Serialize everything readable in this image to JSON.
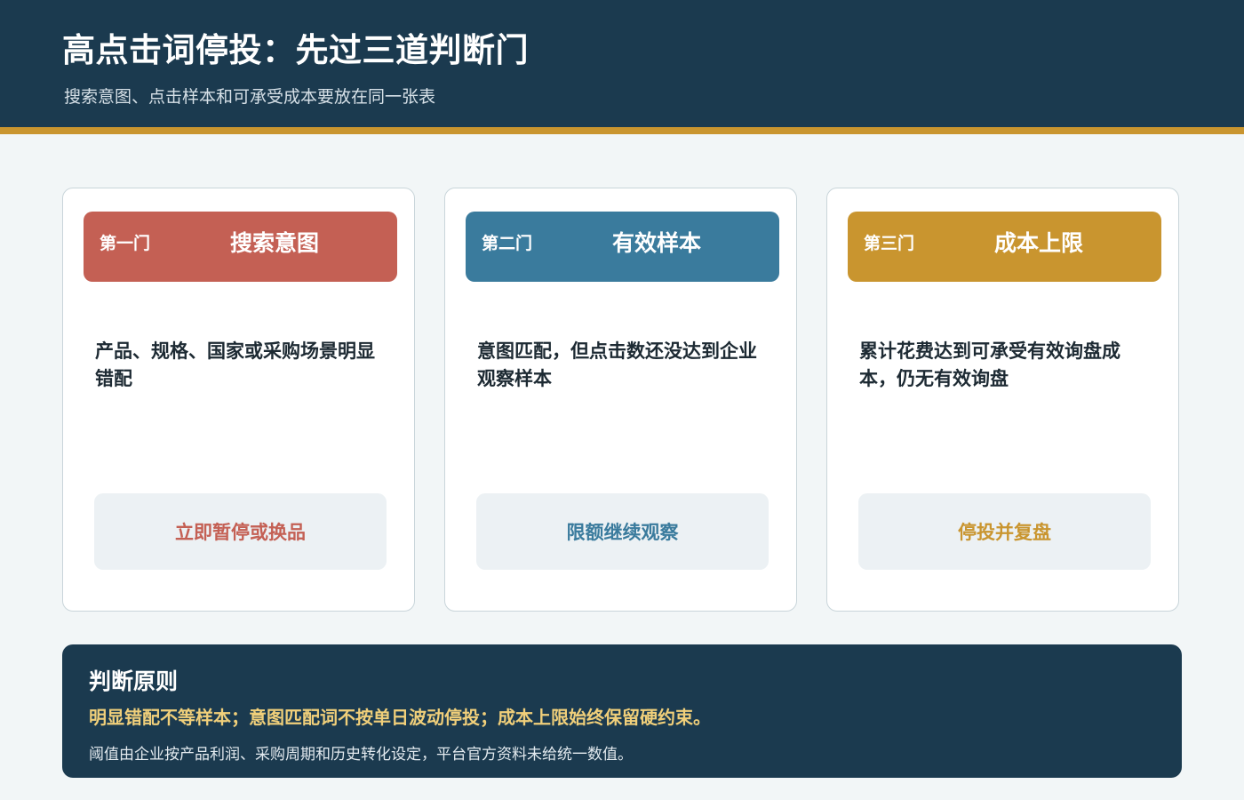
{
  "header": {
    "title": "高点击词停投：先过三道判断门",
    "subtitle": "搜索意图、点击样本和可承受成本要放在同一张表"
  },
  "colors": {
    "header_bg": "#1b3a4f",
    "accent_stripe": "#c9952f",
    "gate_1": "#c46054",
    "gate_2": "#3a7b9d",
    "gate_3": "#c9952f"
  },
  "gates": [
    {
      "label": "第一门",
      "title": "搜索意图",
      "description": "产品、规格、国家或采购场景明显错配",
      "action": "立即暂停或换品"
    },
    {
      "label": "第二门",
      "title": "有效样本",
      "description": "意图匹配，但点击数还没达到企业观察样本",
      "action": "限额继续观察"
    },
    {
      "label": "第三门",
      "title": "成本上限",
      "description": "累计花费达到可承受有效询盘成本，仍无有效询盘",
      "action": "停投并复盘"
    }
  ],
  "principle": {
    "heading": "判断原则",
    "highlight": "明显错配不等样本；意图匹配词不按单日波动停投；成本上限始终保留硬约束。",
    "note": "阈值由企业按产品利润、采购周期和历史转化设定，平台官方资料未给统一数值。"
  }
}
